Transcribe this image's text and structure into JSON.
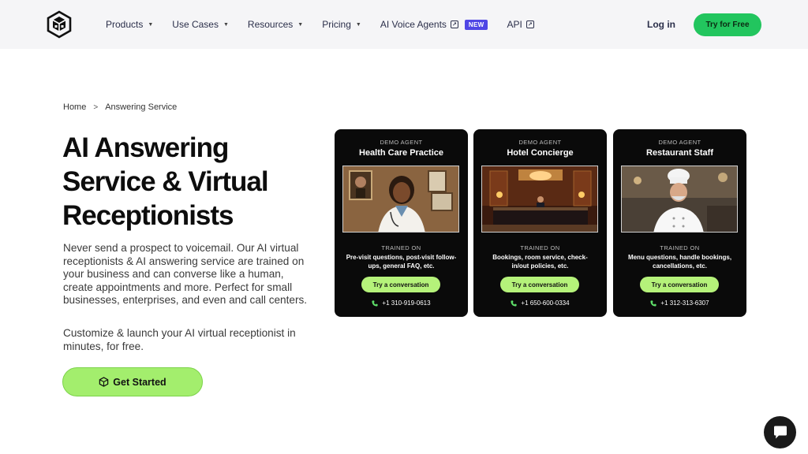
{
  "header": {
    "nav": [
      {
        "label": "Products",
        "type": "dropdown"
      },
      {
        "label": "Use Cases",
        "type": "dropdown"
      },
      {
        "label": "Resources",
        "type": "dropdown"
      },
      {
        "label": "Pricing",
        "type": "dropdown"
      },
      {
        "label": "AI Voice Agents",
        "type": "external",
        "badge": "NEW"
      },
      {
        "label": "API",
        "type": "external"
      }
    ],
    "login_label": "Log in",
    "cta_label": "Try for Free",
    "cta_color": "#22c55e"
  },
  "breadcrumb": {
    "home": "Home",
    "current": "Answering Service"
  },
  "hero": {
    "title_line1": "AI Answering",
    "title_line2": "Service & Virtual",
    "title_line3": "Receptionists",
    "description": "Never send a prospect to voicemail. Our AI virtual receptionists & AI answering service are trained on your business and can converse like a human, create appointments and more. Perfect for small businesses, enterprises, and even and call centers.",
    "description2": "Customize & launch your AI virtual receptionist in minutes, for free.",
    "cta_label": "Get Started",
    "cta_color": "#a3ee6d"
  },
  "cards": [
    {
      "eyebrow": "DEMO AGENT",
      "title": "Health Care Practice",
      "trained_label": "TRAINED ON",
      "trained_desc": "Pre-visit questions, post-visit follow-ups, general FAQ, etc.",
      "button_label": "Try a conversation",
      "phone": "+1 310-919-0613"
    },
    {
      "eyebrow": "DEMO AGENT",
      "title": "Hotel Concierge",
      "trained_label": "TRAINED ON",
      "trained_desc": "Bookings, room service, check-in/out policies, etc.",
      "button_label": "Try a conversation",
      "phone": "+1 650-600-0334"
    },
    {
      "eyebrow": "DEMO AGENT",
      "title": "Restaurant Staff",
      "trained_label": "TRAINED ON",
      "trained_desc": "Menu questions, handle bookings, cancellations, etc.",
      "button_label": "Try a conversation",
      "phone": "+1 312-313-6307"
    }
  ],
  "icons": {
    "logo": "cube-logo-icon",
    "chat": "chat-bubble-icon",
    "phone": "phone-icon"
  }
}
